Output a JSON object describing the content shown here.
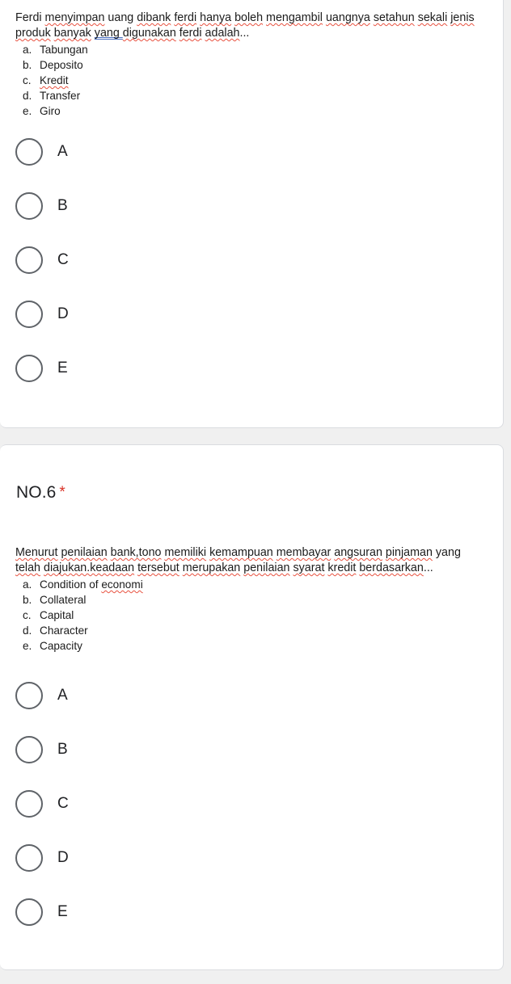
{
  "theme": {
    "page_background": "#f0f0f0",
    "card_background": "#ffffff",
    "card_border": "#dadce0",
    "text_color": "#202124",
    "required_star_color": "#d93025",
    "radio_border_color": "#5f6368",
    "spellcheck_underline_color": "#e8513f",
    "grammar_underline_color": "#4a6fbf"
  },
  "questions": [
    {
      "id": "q5",
      "title": "",
      "required_marker": "",
      "body": {
        "paragraph_line_1": "Ferdi menyimpan uang dibank ferdi hanya boleh mengambil uangnya setahun sekali jenis",
        "paragraph_line_2": "produk banyak yang  digunakan ferdi adalah...",
        "choices": [
          {
            "marker": "a.",
            "text": "Tabungan"
          },
          {
            "marker": "b.",
            "text": "Deposito"
          },
          {
            "marker": "c.",
            "text": "Kredit"
          },
          {
            "marker": "d.",
            "text": "Transfer"
          },
          {
            "marker": "e.",
            "text": "Giro"
          }
        ]
      },
      "options": [
        {
          "label": "A",
          "selected": false
        },
        {
          "label": "B",
          "selected": false
        },
        {
          "label": "C",
          "selected": false
        },
        {
          "label": "D",
          "selected": false
        },
        {
          "label": "E",
          "selected": false
        }
      ]
    },
    {
      "id": "q6",
      "title": "NO.6",
      "required_marker": "*",
      "body": {
        "paragraph_line_1": "Menurut penilaian bank,tono memiliki kemampuan membayar angsuran pinjaman yang",
        "paragraph_line_2": "telah diajukan.keadaan tersebut merupakan penilaian syarat kredit berdasarkan...",
        "choices": [
          {
            "marker": "a.",
            "text": "Condition of economi"
          },
          {
            "marker": "b.",
            "text": "Collateral"
          },
          {
            "marker": "c.",
            "text": "Capital"
          },
          {
            "marker": "d.",
            "text": "Character"
          },
          {
            "marker": "e.",
            "text": "Capacity"
          }
        ]
      },
      "options": [
        {
          "label": "A",
          "selected": false
        },
        {
          "label": "B",
          "selected": false
        },
        {
          "label": "C",
          "selected": false
        },
        {
          "label": "D",
          "selected": false
        },
        {
          "label": "E",
          "selected": false
        }
      ]
    }
  ]
}
